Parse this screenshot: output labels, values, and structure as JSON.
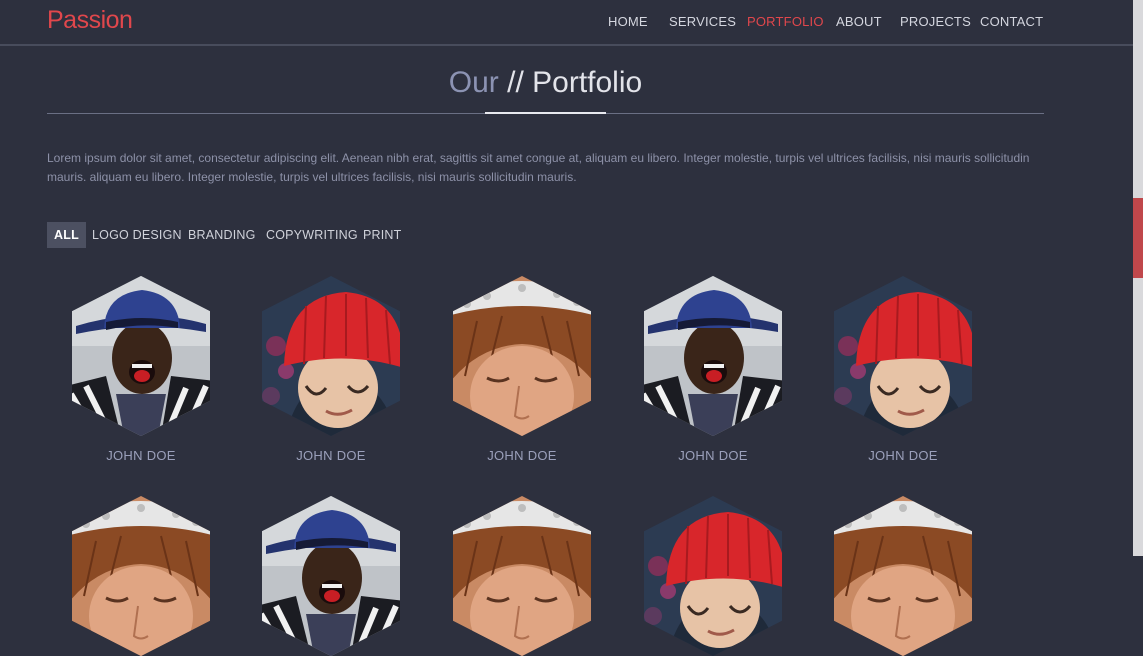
{
  "brand": "Passion",
  "nav": {
    "items": [
      "HOME",
      "SERVICES",
      "PORTFOLIO",
      "ABOUT",
      "PROJECTS",
      "CONTACT"
    ],
    "active": "PORTFOLIO"
  },
  "section": {
    "title_prefix": "Our",
    "title_main": "// Portfolio",
    "intro": "Lorem ipsum dolor sit amet, consectetur adipiscing elit. Aenean nibh erat, sagittis sit amet congue at, aliquam eu libero. Integer molestie, turpis vel ultrices facilisis, nisi mauris sollicitudin mauris. aliquam eu libero. Integer molestie, turpis vel ultrices facilisis, nisi mauris sollicitudin mauris."
  },
  "filters": {
    "items": [
      "ALL",
      "LOGO DESIGN",
      "BRANDING",
      "COPYWRITING",
      "PRINT"
    ],
    "active": "ALL"
  },
  "portfolio": {
    "items": [
      {
        "caption": "JOHN DOE",
        "photo": "man-blue-hat"
      },
      {
        "caption": "JOHN DOE",
        "photo": "woman-red-beanie"
      },
      {
        "caption": "JOHN DOE",
        "photo": "woman-lace-bonnet"
      },
      {
        "caption": "JOHN DOE",
        "photo": "man-blue-hat"
      },
      {
        "caption": "JOHN DOE",
        "photo": "woman-red-beanie"
      },
      {
        "caption": "",
        "photo": "woman-lace-bonnet"
      },
      {
        "caption": "",
        "photo": "man-blue-hat"
      },
      {
        "caption": "",
        "photo": "woman-lace-bonnet"
      },
      {
        "caption": "",
        "photo": "woman-red-beanie"
      },
      {
        "caption": "",
        "photo": "woman-lace-bonnet"
      }
    ]
  },
  "colors": {
    "background": "#2d303e",
    "accent": "#e0474c",
    "text_muted": "#8d91a8"
  }
}
